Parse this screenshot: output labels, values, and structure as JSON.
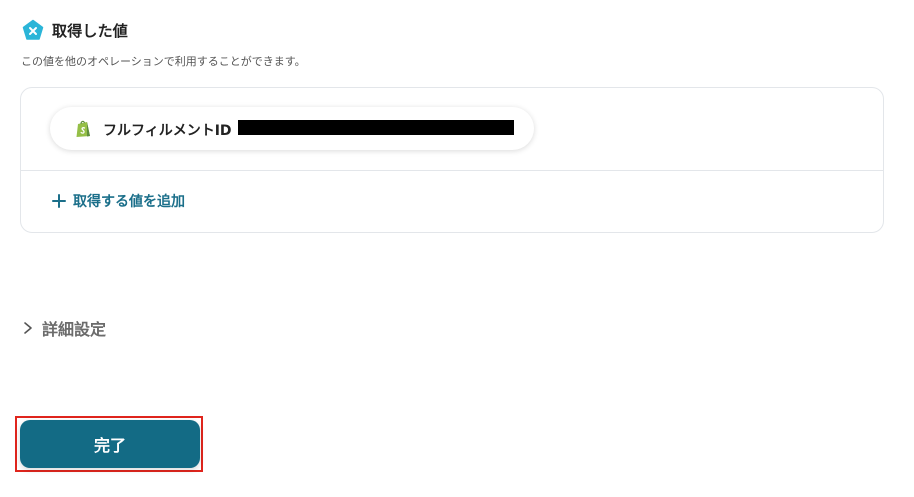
{
  "section": {
    "title": "取得した値",
    "description": "この値を他のオペレーションで利用することができます。",
    "icon": "pentagon-x-icon"
  },
  "values": [
    {
      "label": "フルフィルメントID",
      "icon": "shopify-icon",
      "value_redacted": true
    }
  ],
  "add_value": {
    "label": "取得する値を追加",
    "icon": "plus-icon"
  },
  "details": {
    "label": "詳細設定",
    "icon": "chevron-right-icon"
  },
  "done_button": {
    "label": "完了"
  },
  "colors": {
    "accent": "#136b85",
    "link": "#1b6f8a",
    "icon_cyan": "#2bb5d8",
    "shopify_green": "#95bf47",
    "highlight_red": "#e0251d",
    "border": "#e3e6ea"
  }
}
